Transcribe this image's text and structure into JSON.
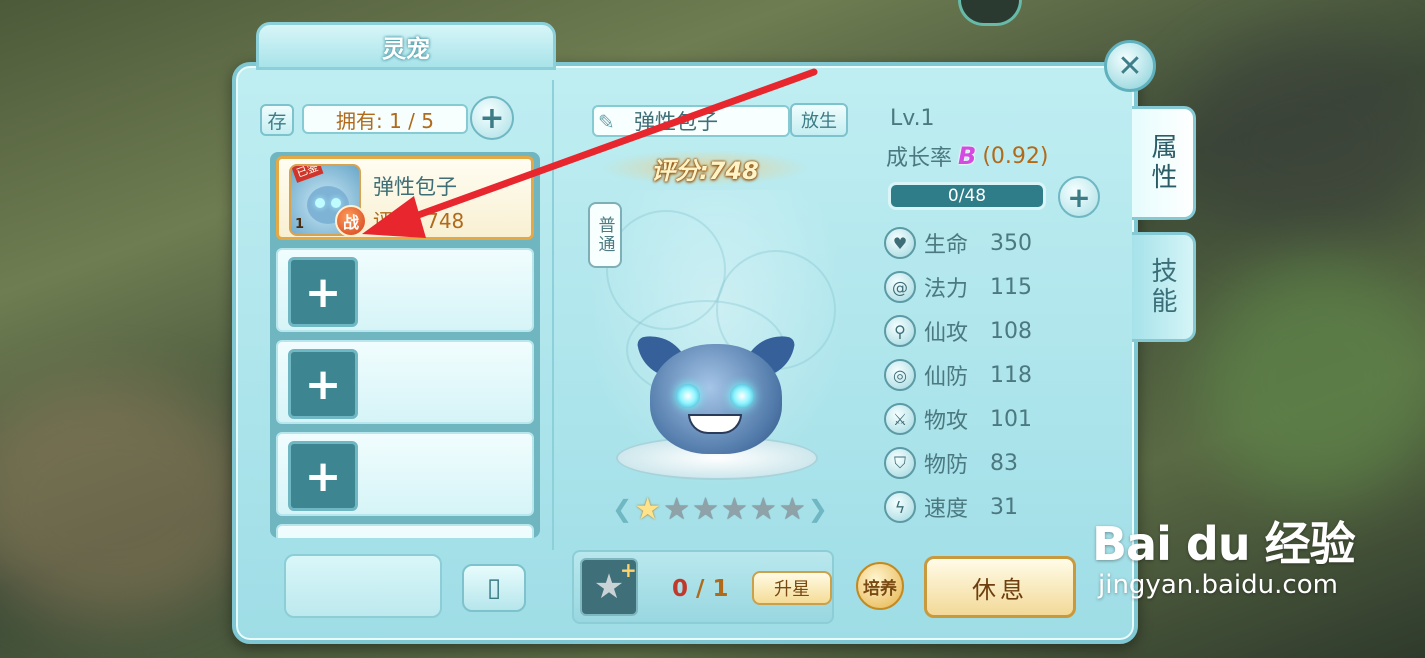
{
  "window": {
    "title": "灵宠",
    "close_icon": "close-icon"
  },
  "side_tabs": [
    {
      "label": "属性",
      "active": true
    },
    {
      "label": "技能",
      "active": false
    }
  ],
  "left": {
    "store_label": "存",
    "owned_text": "拥有: 1 / 5",
    "pet_list": [
      {
        "name": "弹性包子",
        "score_text": "评分: 748",
        "level": "1",
        "ribbon": "已鉴",
        "battle_badge": "战",
        "selected": true
      }
    ],
    "empty_slot_icon": "+"
  },
  "center": {
    "pet_name": "弹性包子",
    "release_label": "放生",
    "score_label": "评分:748",
    "type_tag": "普通",
    "stars_total": 6,
    "stars_lit": 1,
    "item_count": "0",
    "item_max": "1",
    "star_up_label": "升星",
    "cultivate_label": "培养",
    "rest_label": "休息"
  },
  "stats": {
    "level": "Lv.1",
    "growth_label": "成长率",
    "growth_grade": "B",
    "growth_value": "(0.92)",
    "exp_text": "0/48",
    "exp_fraction": 0,
    "rows": [
      {
        "label": "生命",
        "value": "350",
        "icon": "heart-icon"
      },
      {
        "label": "法力",
        "value": "115",
        "icon": "swirl-icon"
      },
      {
        "label": "仙攻",
        "value": "108",
        "icon": "wand-icon"
      },
      {
        "label": "仙防",
        "value": "118",
        "icon": "vortex-icon"
      },
      {
        "label": "物攻",
        "value": "101",
        "icon": "sword-icon"
      },
      {
        "label": "物防",
        "value": "83",
        "icon": "shield-icon"
      },
      {
        "label": "速度",
        "value": "31",
        "icon": "lightning-icon"
      }
    ]
  },
  "watermark": {
    "brand": "Bai du 经验",
    "url": "jingyan.baidu.com"
  },
  "colors": {
    "panel": "#9fdde6",
    "accent_orange": "#b06a1a",
    "arrow": "#e8262e"
  }
}
